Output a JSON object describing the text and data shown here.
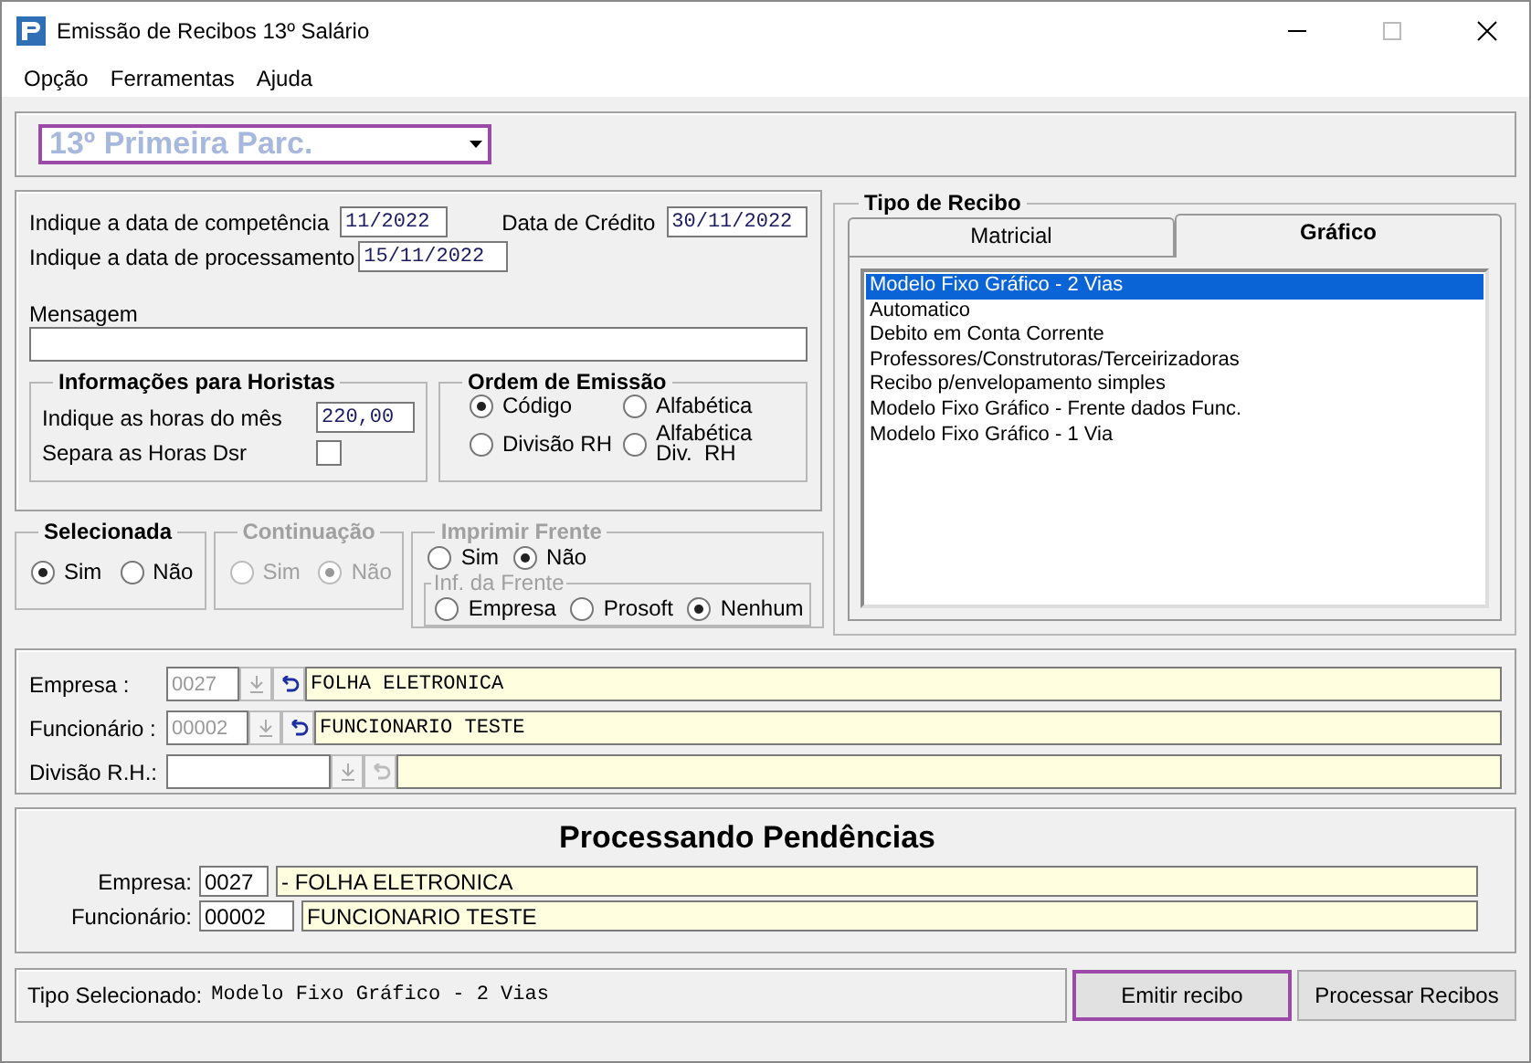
{
  "window": {
    "title": "Emissão de Recibos 13º Salário"
  },
  "menu": [
    "Opção",
    "Ferramentas",
    "Ajuda"
  ],
  "parcel_select": {
    "value": "13º Primeira Parc."
  },
  "competencia": {
    "label": "Indique a data de competência",
    "value": "11/2022"
  },
  "credito": {
    "label": "Data de Crédito",
    "value": "30/11/2022"
  },
  "processamento": {
    "label": "Indique a data de processamento",
    "value": "15/11/2022"
  },
  "mensagem": {
    "label": "Mensagem"
  },
  "horistas": {
    "title": "Informações para Horistas",
    "hours_label": "Indique as horas do mês",
    "hours_value": "220,00",
    "dsr_label": "Separa as Horas Dsr",
    "dsr_checked": false
  },
  "ordem": {
    "title": "Ordem de Emissão",
    "options": [
      {
        "label": "Código",
        "selected": true
      },
      {
        "label": "Alfabética",
        "selected": false
      },
      {
        "label": "Divisão RH",
        "selected": false
      },
      {
        "label": "Alfabética Div.  RH",
        "selected": false
      }
    ]
  },
  "selecionada": {
    "title": "Selecionada",
    "disabled": false,
    "options": [
      {
        "label": "Sim",
        "selected": true,
        "disabled": false
      },
      {
        "label": "Não",
        "selected": false,
        "disabled": false
      }
    ]
  },
  "continuacao": {
    "title": "Continuação",
    "disabled": true,
    "options": [
      {
        "label": "Sim",
        "selected": false,
        "disabled": true
      },
      {
        "label": "Não",
        "selected": true,
        "disabled": true
      }
    ]
  },
  "imprimir_frente": {
    "title": "Imprimir Frente",
    "disabled": true,
    "options": [
      {
        "label": "Sim",
        "selected": false,
        "disabled": false
      },
      {
        "label": "Não",
        "selected": true,
        "disabled": false
      }
    ],
    "inf_frente": {
      "title": "Inf. da Frente",
      "disabled": true,
      "options": [
        {
          "label": "Empresa",
          "selected": false,
          "disabled": false
        },
        {
          "label": "Prosoft",
          "selected": false,
          "disabled": false
        },
        {
          "label": "Nenhum",
          "selected": true,
          "disabled": false
        }
      ]
    }
  },
  "tipo_recibo": {
    "title": "Tipo de Recibo",
    "tabs": [
      {
        "label": "Matricial",
        "selected": false
      },
      {
        "label": "Gráfico",
        "selected": true
      }
    ],
    "items": [
      {
        "label": "Modelo Fixo Gráfico - 2 Vias",
        "selected": true
      },
      {
        "label": "Automatico",
        "selected": false
      },
      {
        "label": "Debito em Conta Corrente",
        "selected": false
      },
      {
        "label": "Professores/Construtoras/Terceirizadoras",
        "selected": false
      },
      {
        "label": "Recibo p/envelopamento simples",
        "selected": false
      },
      {
        "label": "Modelo Fixo Gráfico - Frente dados Func.",
        "selected": false
      },
      {
        "label": "Modelo Fixo Gráfico - 1 Via",
        "selected": false
      }
    ]
  },
  "lookups": [
    {
      "label": "Empresa :",
      "code": "0027",
      "name": "FOLHA ELETRONICA",
      "disabled": false
    },
    {
      "label": "Funcionário :",
      "code": "00002",
      "name": "FUNCIONARIO TESTE",
      "disabled": false
    },
    {
      "label": "Divisão R.H.:",
      "disabled": true
    }
  ],
  "pendencias": {
    "title": "Processando Pendências",
    "rows": [
      {
        "label": "Empresa:",
        "code": "0027",
        "name": "- FOLHA ELETRONICA"
      },
      {
        "label": "Funcionário:",
        "code": "00002",
        "name": "FUNCIONARIO TESTE"
      }
    ]
  },
  "status": {
    "label": "Tipo Selecionado:",
    "value": "Modelo Fixo Gráfico - 2 Vias"
  },
  "buttons": [
    {
      "label": "Emitir recibo",
      "focused": true
    },
    {
      "label": "Processar Recibos",
      "focused": false
    }
  ]
}
